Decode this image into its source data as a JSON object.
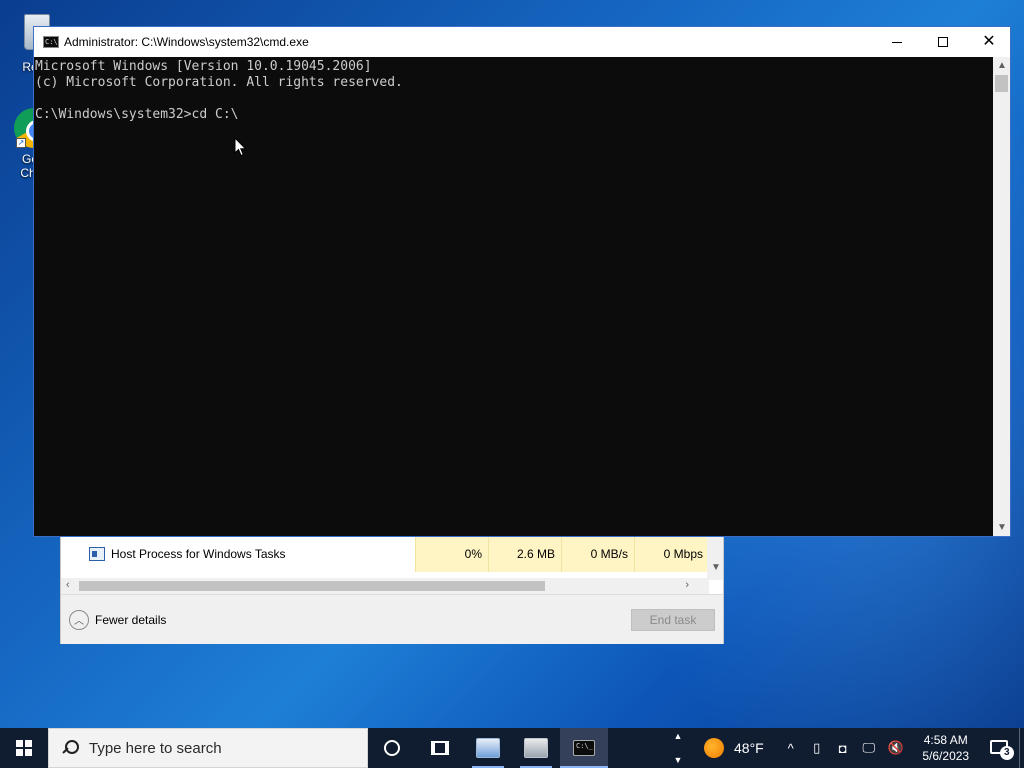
{
  "desktop": {
    "icons": [
      {
        "label": "Recy"
      },
      {
        "label": "Go\nChr"
      }
    ]
  },
  "cmd": {
    "title": "Administrator: C:\\Windows\\system32\\cmd.exe",
    "lines": [
      "Microsoft Windows [Version 10.0.19045.2006]",
      "(c) Microsoft Corporation. All rights reserved.",
      "",
      "C:\\Windows\\system32>cd C:\\"
    ]
  },
  "taskmgr": {
    "row": {
      "name": "Host Process for Windows Tasks",
      "cpu": "0%",
      "memory": "2.6 MB",
      "disk": "0 MB/s",
      "network": "0 Mbps"
    },
    "fewer_details": "Fewer details",
    "end_task": "End task"
  },
  "taskbar": {
    "search_placeholder": "Type here to search",
    "weather_temp": "48°F",
    "time": "4:58 AM",
    "date": "5/6/2023",
    "notification_count": "3"
  }
}
